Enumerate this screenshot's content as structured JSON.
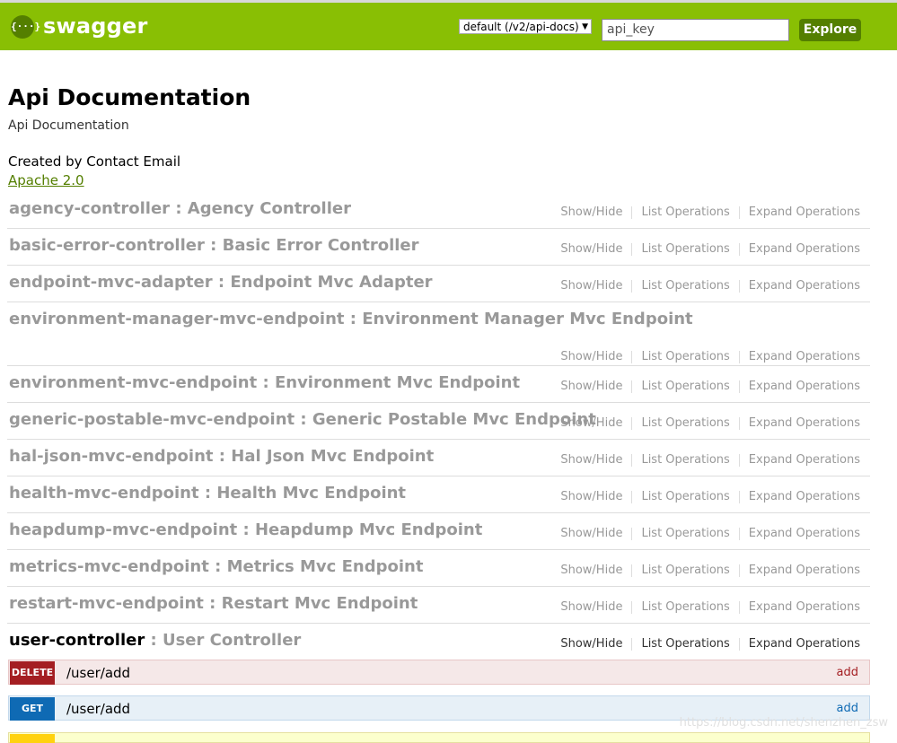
{
  "header": {
    "logo_glyph": "{···}",
    "logo_text": "swagger",
    "select_value": "default (/v2/api-docs)",
    "input_placeholder": "api_key",
    "explore_label": "Explore",
    "colors": {
      "bar": "#89bf04",
      "button": "#547f00"
    }
  },
  "info": {
    "title": "Api Documentation",
    "description": "Api Documentation",
    "contact": "Created by Contact Email",
    "license": "Apache 2.0"
  },
  "ops_labels": {
    "show_hide": "Show/Hide",
    "list": "List Operations",
    "expand": "Expand Operations"
  },
  "resources": [
    {
      "name": "agency-controller",
      "sep": " : ",
      "desc": "Agency Controller"
    },
    {
      "name": "basic-error-controller",
      "sep": " : ",
      "desc": "Basic Error Controller"
    },
    {
      "name": "endpoint-mvc-adapter",
      "sep": " : ",
      "desc": "Endpoint Mvc Adapter"
    },
    {
      "name": "environment-manager-mvc-endpoint",
      "sep": " : ",
      "desc": "Environment Manager Mvc Endpoint"
    },
    {
      "name": "environment-mvc-endpoint",
      "sep": " : ",
      "desc": "Environment Mvc Endpoint"
    },
    {
      "name": "generic-postable-mvc-endpoint",
      "sep": " : ",
      "desc": "Generic Postable Mvc Endpoint"
    },
    {
      "name": "hal-json-mvc-endpoint",
      "sep": " : ",
      "desc": "Hal Json Mvc Endpoint"
    },
    {
      "name": "health-mvc-endpoint",
      "sep": " : ",
      "desc": "Health Mvc Endpoint"
    },
    {
      "name": "heapdump-mvc-endpoint",
      "sep": " : ",
      "desc": "Heapdump Mvc Endpoint"
    },
    {
      "name": "metrics-mvc-endpoint",
      "sep": " : ",
      "desc": "Metrics Mvc Endpoint"
    },
    {
      "name": "restart-mvc-endpoint",
      "sep": " : ",
      "desc": "Restart Mvc Endpoint"
    },
    {
      "name": "user-controller",
      "sep": " : ",
      "desc": "User Controller"
    }
  ],
  "operations": [
    {
      "method": "DELETE",
      "path": "/user/add",
      "summary": "add"
    },
    {
      "method": "GET",
      "path": "/user/add",
      "summary": "add"
    }
  ],
  "watermark": "https://blog.csdn.net/shenzhen_zsw"
}
